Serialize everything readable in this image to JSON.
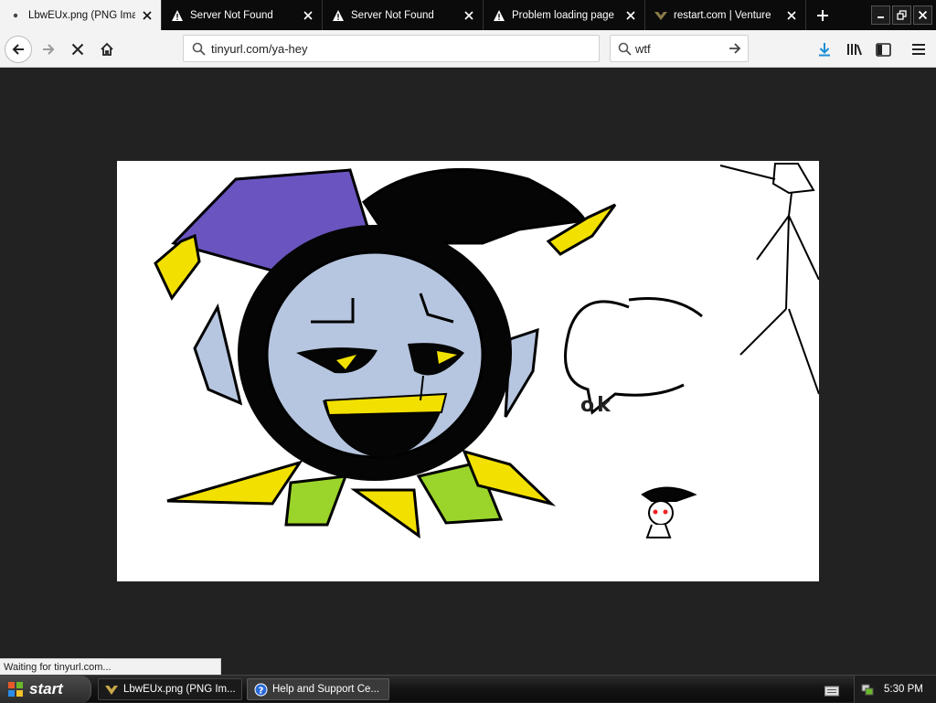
{
  "tabs": [
    {
      "title": "LbwEUx.png (PNG Imag",
      "icon": "dot-icon",
      "active": true
    },
    {
      "title": "Server Not Found",
      "icon": "warning-icon",
      "active": false
    },
    {
      "title": "Server Not Found",
      "icon": "warning-icon",
      "active": false
    },
    {
      "title": "Problem loading page",
      "icon": "warning-icon",
      "active": false
    },
    {
      "title": "restart.com | Venture",
      "icon": "site-logo-icon",
      "active": false
    }
  ],
  "navbar": {
    "url": "tinyurl.com/ya-hey",
    "search_value": "wtf"
  },
  "content": {
    "speech_bubble_text": "ok"
  },
  "status": {
    "text": "Waiting for tinyurl.com..."
  },
  "taskbar": {
    "start_label": "start",
    "items": [
      {
        "label": "LbwEUx.png (PNG Im...",
        "icon": "firefox-icon"
      },
      {
        "label": "Help and Support Ce...",
        "icon": "help-icon"
      }
    ],
    "clock": "5:30 PM"
  },
  "colors": {
    "accent_download": "#1a8fd6",
    "jester_purple": "#6a55c0",
    "jester_yellow": "#f2e000",
    "jester_green": "#9bd42a",
    "face_blue": "#b7c6e0"
  }
}
